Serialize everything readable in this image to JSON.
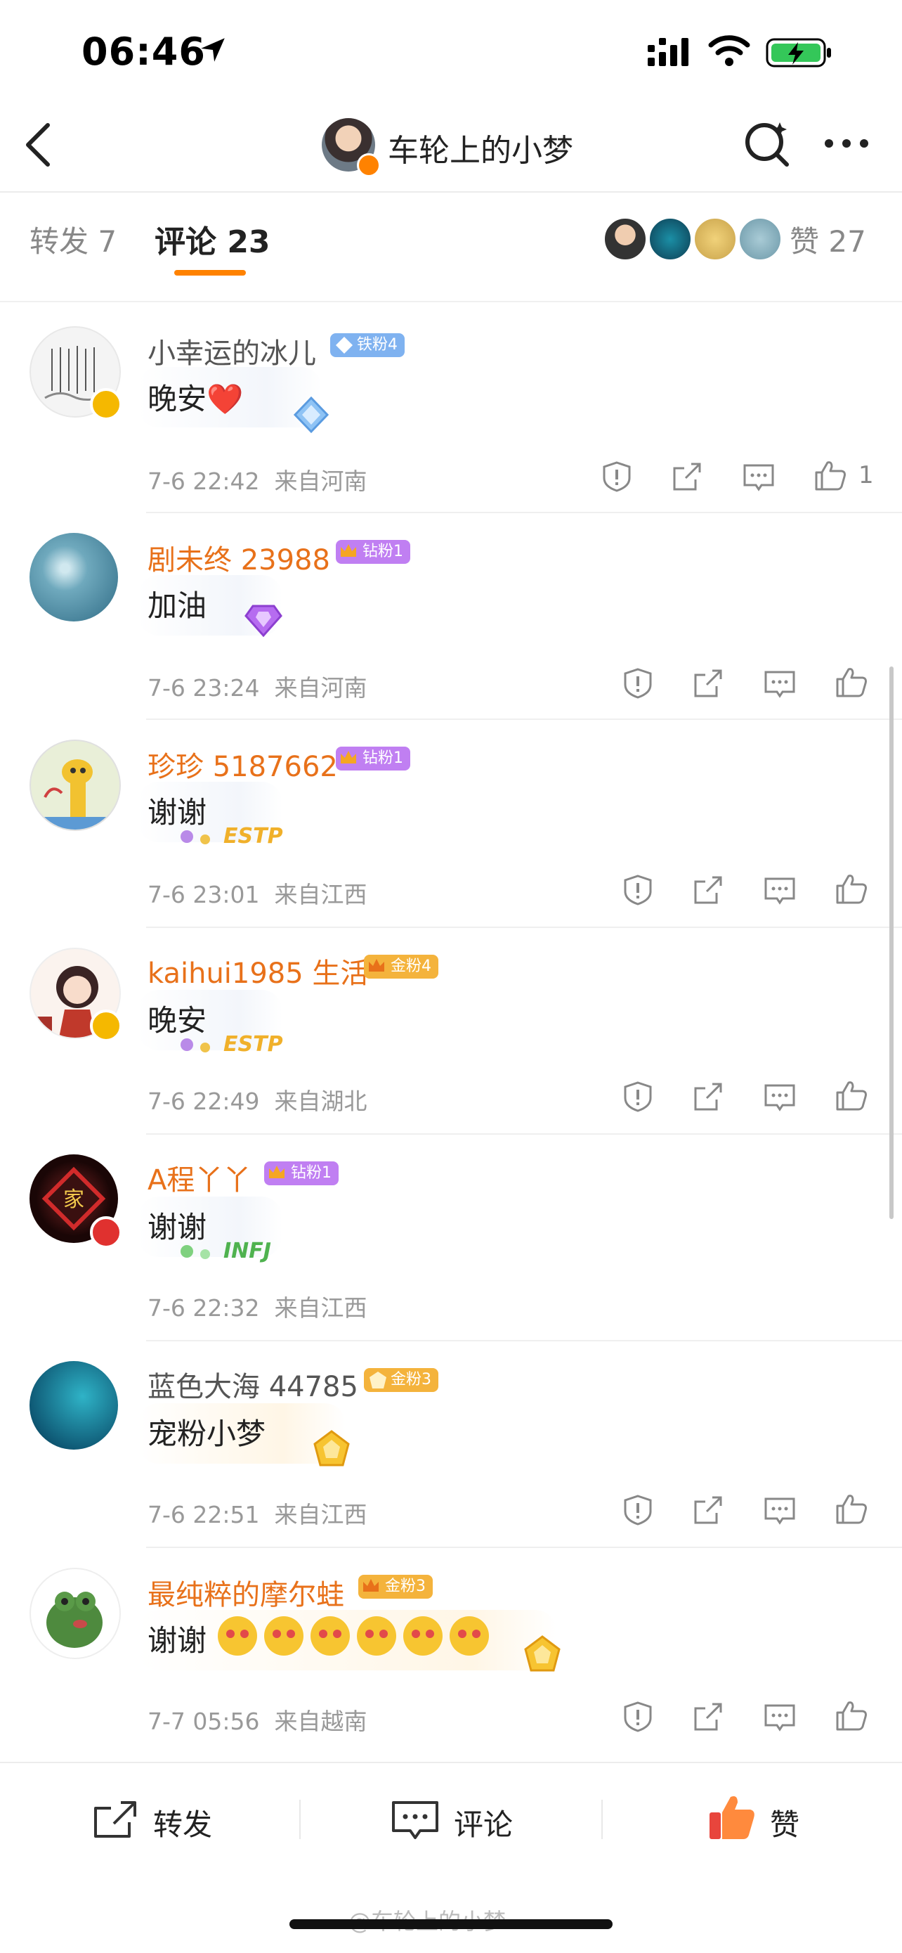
{
  "status_bar": {
    "time": "06:46"
  },
  "header": {
    "title": "车轮上的小梦"
  },
  "tabs": {
    "repost_label": "转发 7",
    "comment_label": "评论 23",
    "like_label": "赞 27"
  },
  "comments": [
    {
      "name": "小幸运的冰儿",
      "badge": "铁粉4",
      "text": "晚安❤️",
      "time": "7-6 22:42",
      "location": "来自河南",
      "likes": "1"
    },
    {
      "name": "剧未终 23988",
      "badge": "钻粉1",
      "text": "加油",
      "time": "7-6 23:24",
      "location": "来自河南"
    },
    {
      "name": "珍珍 5187662",
      "badge": "钻粉1",
      "text": "谢谢",
      "time": "7-6 23:01",
      "location": "来自江西"
    },
    {
      "name": "kaihui1985 生活",
      "badge": "金粉4",
      "text": "晚安",
      "time": "7-6 22:49",
      "location": "来自湖北"
    },
    {
      "name": "A程丫丫",
      "badge": "钻粉1",
      "text": "谢谢",
      "time": "7-6 22:32",
      "location": "来自江西"
    },
    {
      "name": "蓝色大海 44785",
      "badge": "金粉3",
      "text": "宠粉小梦",
      "time": "7-6 22:51",
      "location": "来自江西"
    },
    {
      "name": "最纯粹的摩尔蛙",
      "badge": "金粉3",
      "text": "谢谢",
      "time": "7-7 05:56",
      "location": "来自越南"
    }
  ],
  "bubble_tags": {
    "estp": "ESTP",
    "infj": "INFJ"
  },
  "avatar_text": {
    "home_char": "家"
  },
  "bottom_bar": {
    "repost": "转发",
    "comment": "评论",
    "like": "赞"
  },
  "watermark": "@车轮上的小梦",
  "colors": {
    "accent": "#ff8200",
    "name_orange": "#e8711a",
    "name_gray": "#555555",
    "iron": "#7fb2f0",
    "diamond": "#c07ff2",
    "gold": "#f4b33c"
  },
  "icons": [
    "back-icon",
    "search-icon",
    "more-icon",
    "report-icon",
    "share-icon",
    "reply-icon",
    "like-icon",
    "repost-icon",
    "comment-icon"
  ]
}
